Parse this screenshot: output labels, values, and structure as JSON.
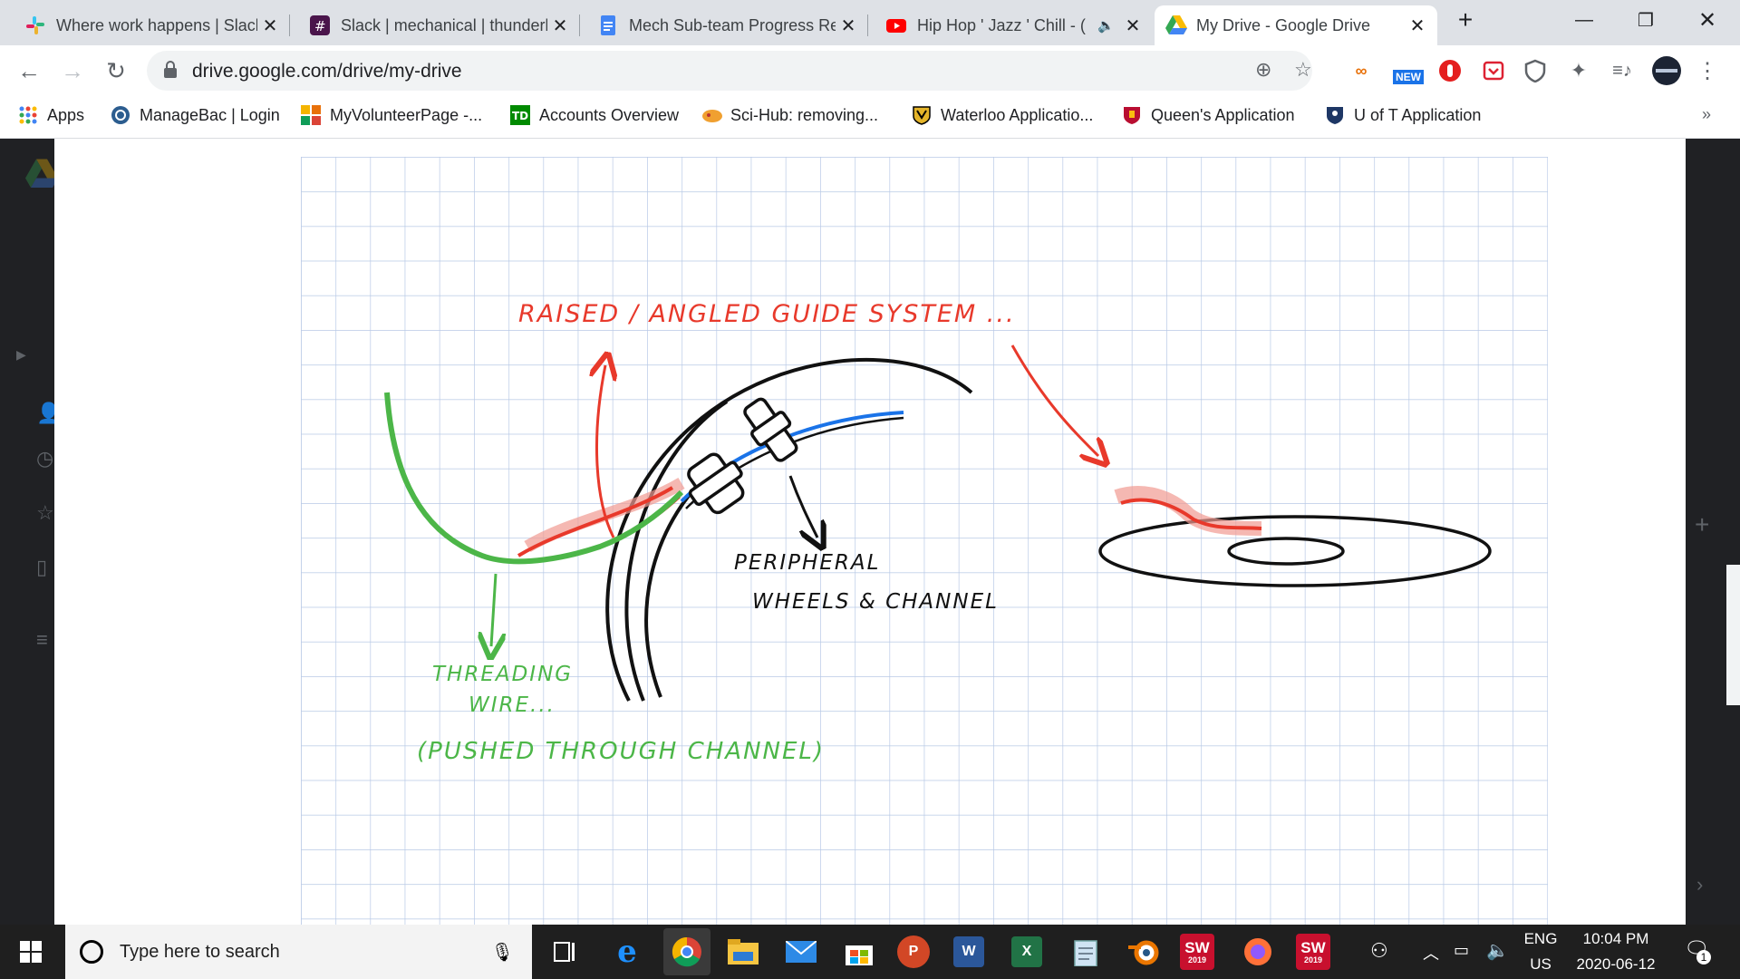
{
  "browser": {
    "tabs": [
      {
        "title": "Where work happens | Slack",
        "icon": "slack-icon"
      },
      {
        "title": "Slack | mechanical | thunderbots",
        "icon": "slack-workspace-icon"
      },
      {
        "title": "Mech Sub-team Progress Report",
        "icon": "google-docs-icon"
      },
      {
        "title": "Hip Hop ' Jazz ' Chill - (",
        "icon": "youtube-icon"
      },
      {
        "title": "My Drive - Google Drive",
        "icon": "google-drive-icon"
      }
    ],
    "url": "drive.google.com/drive/my-drive",
    "extension_badge": "NEW",
    "bookmarks": [
      {
        "label": "Apps",
        "icon": "apps-grid-icon"
      },
      {
        "label": "ManageBac | Login",
        "icon": "managebac-icon"
      },
      {
        "label": "MyVolunteerPage -...",
        "icon": "myvolunteerpage-icon"
      },
      {
        "label": "Accounts Overview",
        "icon": "td-bank-icon"
      },
      {
        "label": "Sci-Hub: removing...",
        "icon": "scihub-icon"
      },
      {
        "label": "Waterloo Applicatio...",
        "icon": "waterloo-crest-icon"
      },
      {
        "label": "Queen's Application",
        "icon": "queens-crest-icon"
      },
      {
        "label": "U of T Application",
        "icon": "uoft-crest-icon"
      }
    ]
  },
  "sketch": {
    "labels": {
      "raised": "RAISED / ANGLED GUIDE SYSTEM ...",
      "peripheral_1": "PERIPHERAL",
      "peripheral_2": "WHEELS & CHANNEL",
      "threading_1": "THREADING",
      "threading_2": "WIRE...",
      "pushed": "(PUSHED THROUGH CHANNEL)"
    },
    "colors": {
      "red": "#e8392b",
      "green": "#4cb648",
      "blue": "#1a73e8",
      "ink": "#111111",
      "grid": "#b8c9e6"
    }
  },
  "taskbar": {
    "search_placeholder": "Type here to search",
    "lang_1": "ENG",
    "lang_2": "US",
    "time": "10:04 PM",
    "date": "2020-06-12",
    "notifications": "1",
    "apps": [
      "task-view-icon",
      "edge-icon",
      "chrome-icon",
      "file-explorer-icon",
      "mail-icon",
      "store-icon",
      "powerpoint-icon",
      "word-icon",
      "excel-icon",
      "notepad-icon",
      "blender-icon",
      "solidworks-icon",
      "firefox-icon",
      "solidworks-2-icon"
    ],
    "sw_year": "2019"
  }
}
